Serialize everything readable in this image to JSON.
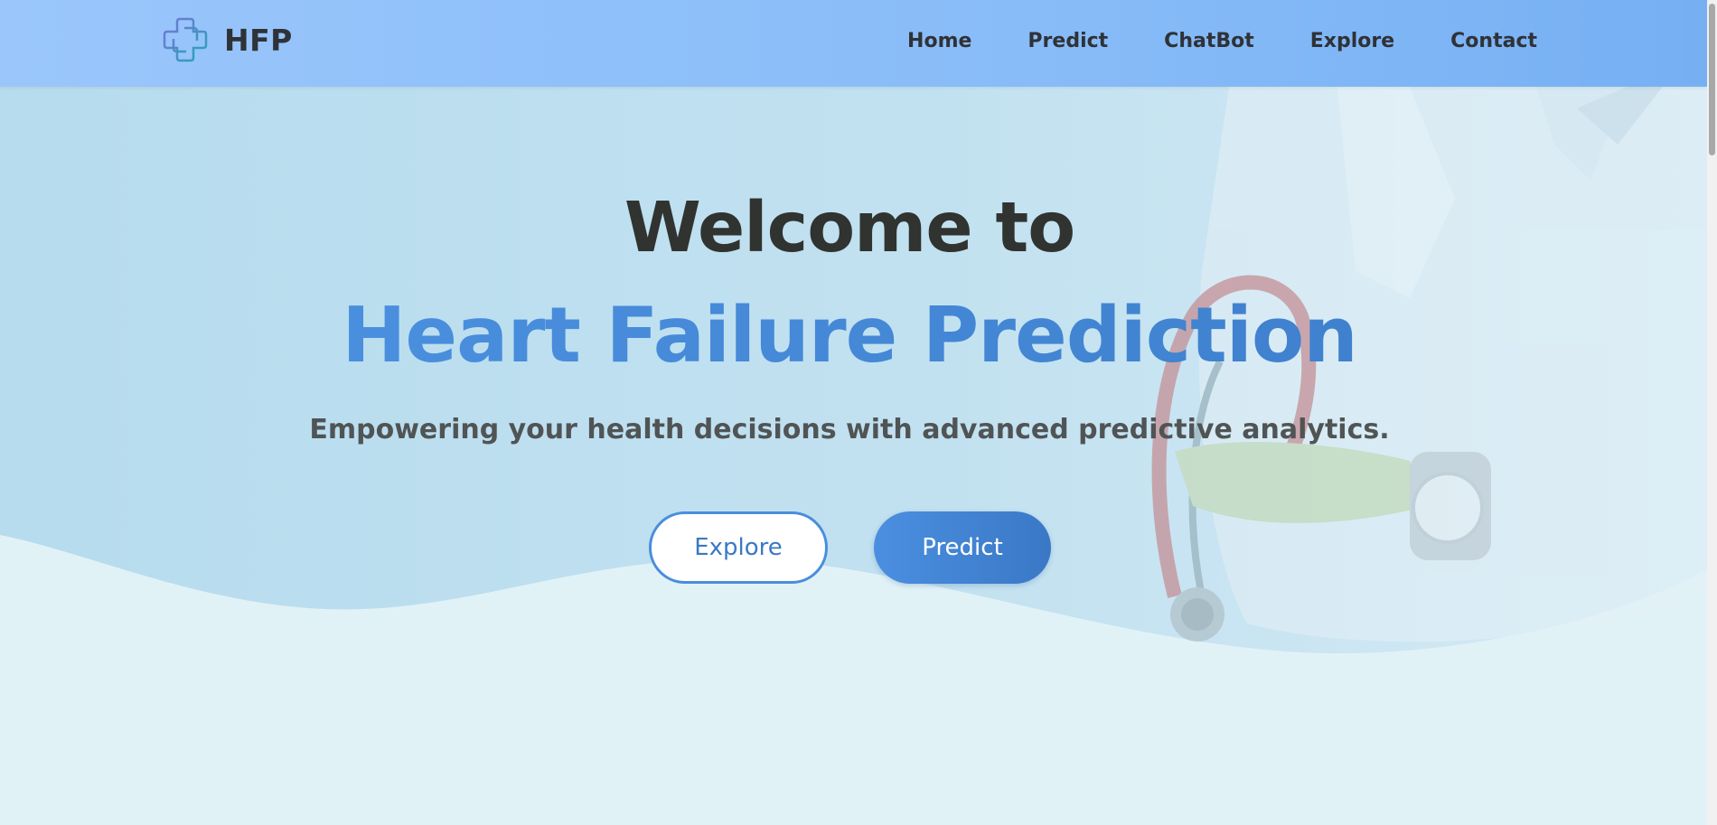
{
  "brand": {
    "name": "HFP",
    "logo_icon": "medical-cross-icon"
  },
  "nav": {
    "items": [
      {
        "label": "Home"
      },
      {
        "label": "Predict"
      },
      {
        "label": "ChatBot"
      },
      {
        "label": "Explore"
      },
      {
        "label": "Contact"
      }
    ]
  },
  "hero": {
    "title": "Welcome to",
    "headline": "Heart Failure Prediction",
    "subtitle": "Empowering your health decisions with advanced predictive analytics.",
    "explore_label": "Explore",
    "predict_label": "Predict",
    "background_icon": "doctor-stethoscope-photo"
  },
  "colors": {
    "navbar": "#88bcf8",
    "accent": "#4a8ddd",
    "text_dark": "#30332f",
    "background": "#e1f2f7"
  }
}
